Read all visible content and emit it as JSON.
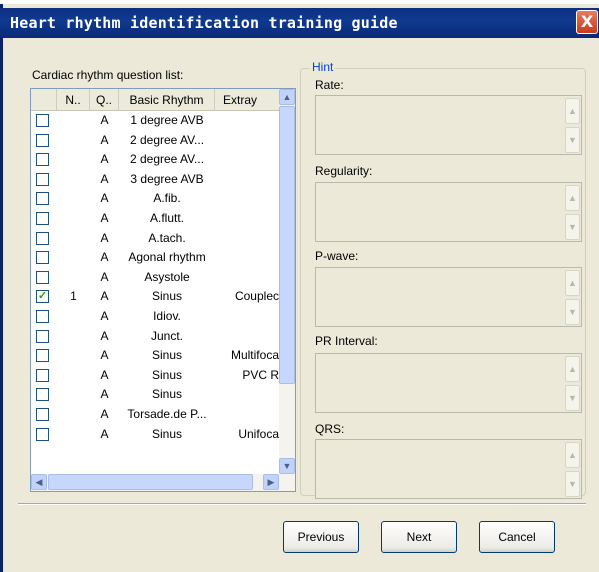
{
  "window": {
    "title": "Heart rhythm identification training guide",
    "close_symbol": "X"
  },
  "list": {
    "label": "Cardiac rhythm question list:",
    "columns": [
      "N..",
      "Q..",
      "Basic Rhythm",
      "Extray"
    ],
    "rows": [
      {
        "checked": false,
        "n": "",
        "q": "A",
        "rhythm": "1 degree AVB",
        "extra": ""
      },
      {
        "checked": false,
        "n": "",
        "q": "A",
        "rhythm": "2 degree AV...",
        "extra": ""
      },
      {
        "checked": false,
        "n": "",
        "q": "A",
        "rhythm": "2 degree AV...",
        "extra": ""
      },
      {
        "checked": false,
        "n": "",
        "q": "A",
        "rhythm": "3 degree AVB",
        "extra": ""
      },
      {
        "checked": false,
        "n": "",
        "q": "A",
        "rhythm": "A.fib.",
        "extra": ""
      },
      {
        "checked": false,
        "n": "",
        "q": "A",
        "rhythm": "A.flutt.",
        "extra": ""
      },
      {
        "checked": false,
        "n": "",
        "q": "A",
        "rhythm": "A.tach.",
        "extra": ""
      },
      {
        "checked": false,
        "n": "",
        "q": "A",
        "rhythm": "Agonal rhythm",
        "extra": ""
      },
      {
        "checked": false,
        "n": "",
        "q": "A",
        "rhythm": "Asystole",
        "extra": ""
      },
      {
        "checked": true,
        "n": "1",
        "q": "A",
        "rhythm": "Sinus",
        "extra": "Couplec"
      },
      {
        "checked": false,
        "n": "",
        "q": "A",
        "rhythm": "Idiov.",
        "extra": ""
      },
      {
        "checked": false,
        "n": "",
        "q": "A",
        "rhythm": "Junct.",
        "extra": ""
      },
      {
        "checked": false,
        "n": "",
        "q": "A",
        "rhythm": "Sinus",
        "extra": "Multifoca"
      },
      {
        "checked": false,
        "n": "",
        "q": "A",
        "rhythm": "Sinus",
        "extra": "PVC R"
      },
      {
        "checked": false,
        "n": "",
        "q": "A",
        "rhythm": "Sinus",
        "extra": ""
      },
      {
        "checked": false,
        "n": "",
        "q": "A",
        "rhythm": "Torsade.de P...",
        "extra": ""
      },
      {
        "checked": false,
        "n": "",
        "q": "A",
        "rhythm": "Sinus",
        "extra": "Unifoca"
      }
    ]
  },
  "hint": {
    "title": "Hint",
    "fields": [
      "Rate:",
      "Regularity:",
      "P-wave:",
      "PR Interval:",
      "QRS:"
    ]
  },
  "buttons": {
    "previous": "Previous",
    "next": "Next",
    "cancel": "Cancel"
  },
  "colors": {
    "titlebar": "#0a246a",
    "hint_title": "#0046d5",
    "check": "#21a121"
  }
}
